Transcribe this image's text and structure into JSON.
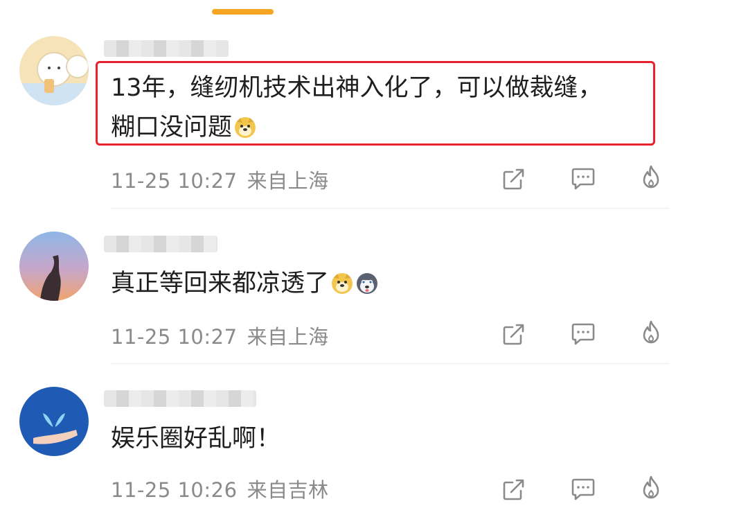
{
  "comments": [
    {
      "text_line1": "13年，缝纫机技术出神入化了，可以做裁缝，",
      "text_line2": "糊口没问题",
      "time": "11-25 10:27",
      "location": "来自上海",
      "emojis": [
        "doge-emoji"
      ]
    },
    {
      "text": "真正等回来都凉透了",
      "time": "11-25 10:27",
      "location": "来自上海",
      "emojis": [
        "doge-emoji",
        "husky-emoji"
      ]
    },
    {
      "text": "娱乐圈好乱啊！",
      "time": "11-25 10:26",
      "location": "来自吉林",
      "emojis": []
    }
  ],
  "actions": [
    "share-icon",
    "comment-icon",
    "like-fire-icon"
  ],
  "colors": {
    "accent": "#f6a623",
    "highlight_border": "#e8212e",
    "meta_text": "#8a8a8a",
    "icon": "#8a8a8a"
  }
}
